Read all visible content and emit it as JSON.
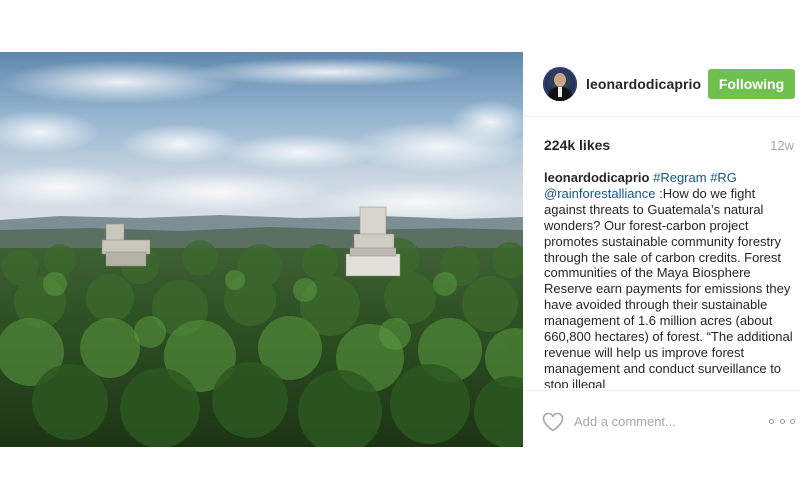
{
  "post": {
    "username": "leonardodicaprio",
    "follow_label": "Following",
    "likes": "224k likes",
    "time": "12w",
    "caption": {
      "author": "leonardodicaprio",
      "tag1": "#Regram",
      "tag2": "#RG",
      "mention": "@rainforestalliance",
      "text": " :How do we fight against threats to Guatemala’s natural wonders? Our forest-carbon project promotes sustainable community forestry through the sale of carbon credits. Forest communities of the Maya Biosphere Reserve earn payments for emissions they have avoided through their sustainable management of 1.6 million acres (about 660,800 hectares) of forest. “The additional revenue will help us improve forest management and conduct surveillance to stop illegal"
    },
    "comment_placeholder": "Add a comment...",
    "icons": {
      "like": "heart-icon",
      "more": "more-options-icon"
    },
    "colors": {
      "follow_button": "#70c050",
      "link": "#125688",
      "muted": "#a5a7aa"
    }
  }
}
